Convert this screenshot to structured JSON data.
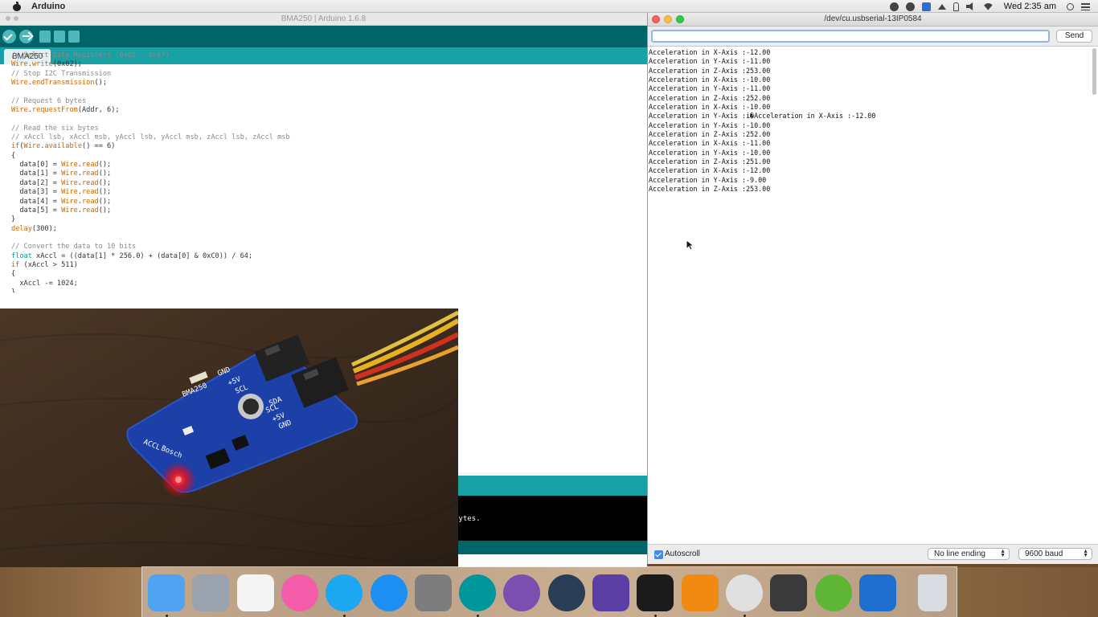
{
  "menubar": {
    "app_name": "Arduino",
    "clock": "Wed 2:35 am"
  },
  "ide": {
    "title": "BMA250 | Arduino 1.6.8",
    "tab_label": "BMA250",
    "code_lines": [
      [
        [
          "c",
          "// Select Data Registers (0x02 - 0x07)"
        ]
      ],
      [
        [
          "f",
          "Wire"
        ],
        [
          "p",
          "."
        ],
        [
          "f",
          "write"
        ],
        [
          "p",
          "(0x02);"
        ]
      ],
      [
        [
          "c",
          "// Stop I2C Transmission"
        ]
      ],
      [
        [
          "f",
          "Wire"
        ],
        [
          "p",
          "."
        ],
        [
          "f",
          "endTransmission"
        ],
        [
          "p",
          "();"
        ]
      ],
      [
        [
          "p",
          ""
        ]
      ],
      [
        [
          "c",
          "// Request 6 bytes"
        ]
      ],
      [
        [
          "f",
          "Wire"
        ],
        [
          "p",
          "."
        ],
        [
          "f",
          "requestFrom"
        ],
        [
          "p",
          "(Addr, 6);"
        ]
      ],
      [
        [
          "p",
          ""
        ]
      ],
      [
        [
          "c",
          "// Read the six bytes"
        ]
      ],
      [
        [
          "c",
          "// xAccl lsb, xAccl msb, yAccl lsb, yAccl msb, zAccl lsb, zAccl msb"
        ]
      ],
      [
        [
          "k",
          "if"
        ],
        [
          "p",
          "("
        ],
        [
          "f",
          "Wire"
        ],
        [
          "p",
          "."
        ],
        [
          "f",
          "available"
        ],
        [
          "p",
          "() == 6)"
        ]
      ],
      [
        [
          "p",
          "{"
        ]
      ],
      [
        [
          "p",
          "  data[0] = "
        ],
        [
          "f",
          "Wire"
        ],
        [
          "p",
          "."
        ],
        [
          "f",
          "read"
        ],
        [
          "p",
          "();"
        ]
      ],
      [
        [
          "p",
          "  data[1] = "
        ],
        [
          "f",
          "Wire"
        ],
        [
          "p",
          "."
        ],
        [
          "f",
          "read"
        ],
        [
          "p",
          "();"
        ]
      ],
      [
        [
          "p",
          "  data[2] = "
        ],
        [
          "f",
          "Wire"
        ],
        [
          "p",
          "."
        ],
        [
          "f",
          "read"
        ],
        [
          "p",
          "();"
        ]
      ],
      [
        [
          "p",
          "  data[3] = "
        ],
        [
          "f",
          "Wire"
        ],
        [
          "p",
          "."
        ],
        [
          "f",
          "read"
        ],
        [
          "p",
          "();"
        ]
      ],
      [
        [
          "p",
          "  data[4] = "
        ],
        [
          "f",
          "Wire"
        ],
        [
          "p",
          "."
        ],
        [
          "f",
          "read"
        ],
        [
          "p",
          "();"
        ]
      ],
      [
        [
          "p",
          "  data[5] = "
        ],
        [
          "f",
          "Wire"
        ],
        [
          "p",
          "."
        ],
        [
          "f",
          "read"
        ],
        [
          "p",
          "();"
        ]
      ],
      [
        [
          "p",
          "}"
        ]
      ],
      [
        [
          "f",
          "delay"
        ],
        [
          "p",
          "(300);"
        ]
      ],
      [
        [
          "p",
          ""
        ]
      ],
      [
        [
          "c",
          "// Convert the data to 10 bits"
        ]
      ],
      [
        [
          "t",
          "float"
        ],
        [
          "p",
          " xAccl = ((data[1] * 256.0) + (data[0] & 0xC0)) / 64;"
        ]
      ],
      [
        [
          "k",
          "if"
        ],
        [
          "p",
          " (xAccl > 511)"
        ]
      ],
      [
        [
          "p",
          "{"
        ]
      ],
      [
        [
          "p",
          "  xAccl -= 1024;"
        ]
      ],
      [
        [
          "p",
          "}"
        ]
      ]
    ],
    "console_text": "bytes."
  },
  "serial": {
    "title": "/dev/cu.usbserial-13IP0584",
    "input_value": "",
    "send_label": "Send",
    "output_lines": [
      "Acceleration in X-Axis :-12.00",
      "Acceleration in Y-Axis :-11.00",
      "Acceleration in Z-Axis :253.00",
      "Acceleration in X-Axis :-10.00",
      "Acceleration in Y-Axis :-11.00",
      "Acceleration in Z-Axis :252.00",
      "Acceleration in X-Axis :-10.00",
      "Acceleration in Y-Axis :i�Acceleration in X-Axis :-12.00",
      "Acceleration in Y-Axis :-10.00",
      "Acceleration in Z-Axis :252.00",
      "Acceleration in X-Axis :-11.00",
      "Acceleration in Y-Axis :-10.00",
      "Acceleration in Z-Axis :251.00",
      "Acceleration in X-Axis :-12.00",
      "Acceleration in Y-Axis :-9.00",
      "Acceleration in Z-Axis :253.00"
    ],
    "autoscroll_label": "Autoscroll",
    "autoscroll_checked": true,
    "line_ending": "No line ending",
    "baud_rate": "9600 baud"
  },
  "board_silkscreen": [
    "GND",
    "+5V",
    "SCL",
    "SCL",
    "+5V",
    "SDA",
    "GND",
    "ACCL",
    "BMA250",
    "Bosch"
  ],
  "dock": {
    "apps": [
      {
        "name": "finder-icon",
        "color": "#4fa3f0",
        "running": true
      },
      {
        "name": "launchpad-icon",
        "color": "#9aa3ad",
        "running": false
      },
      {
        "name": "textedit-icon",
        "color": "#f4f4f4",
        "running": false
      },
      {
        "name": "itunes-icon",
        "color": "#f25ca8",
        "running": false
      },
      {
        "name": "skype-icon",
        "color": "#1ba8f0",
        "running": true
      },
      {
        "name": "app-store-icon",
        "color": "#1d8ff2",
        "running": false
      },
      {
        "name": "system-preferences-icon",
        "color": "#7d7d7d",
        "running": false
      },
      {
        "name": "arduino-icon",
        "color": "#00979c",
        "running": true
      },
      {
        "name": "github-icon",
        "color": "#7b4fb0",
        "running": false
      },
      {
        "name": "quicktime-icon",
        "color": "#2a3d56",
        "running": false
      },
      {
        "name": "imovie-icon",
        "color": "#5b3fa5",
        "running": false
      },
      {
        "name": "terminal-icon",
        "color": "#1b1b1b",
        "running": true
      },
      {
        "name": "vlc-icon",
        "color": "#f08a12",
        "running": false
      },
      {
        "name": "chrome-icon",
        "color": "#e0e0e0",
        "running": true
      },
      {
        "name": "media-player-icon",
        "color": "#3a3a3a",
        "running": false
      },
      {
        "name": "utorrent-icon",
        "color": "#5fb536",
        "running": false
      },
      {
        "name": "teamviewer-icon",
        "color": "#1f6fd0",
        "running": false
      },
      {
        "name": "trash-icon",
        "color": "#d9dde2",
        "running": false
      }
    ]
  }
}
